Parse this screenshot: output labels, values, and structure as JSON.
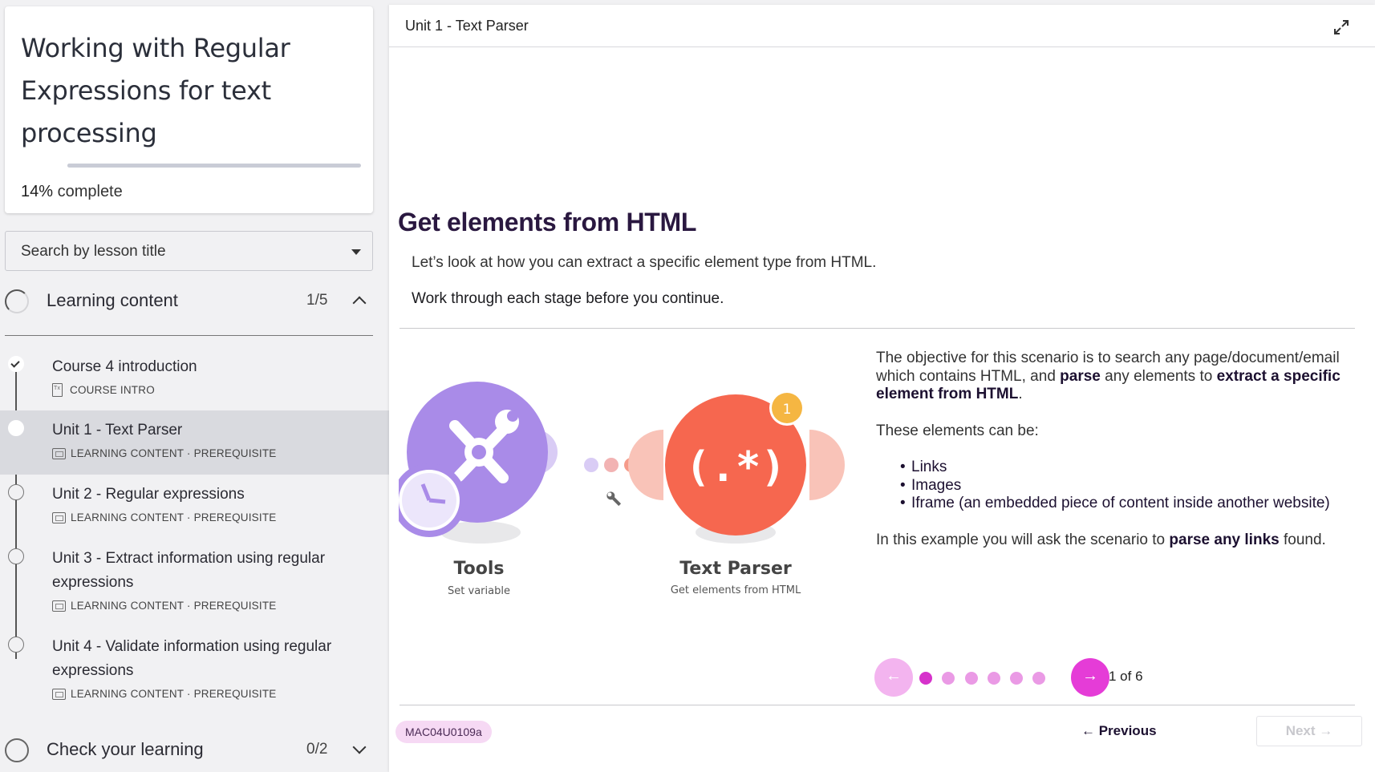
{
  "course": {
    "title": "Working with Regular Expressions for text processing",
    "progress_percent": 14,
    "progress_value": "14%",
    "progress_suffix": " complete"
  },
  "search": {
    "placeholder": "Search by lesson title"
  },
  "sections": [
    {
      "title": "Learning content",
      "count": "1/5",
      "expanded": true,
      "lessons": [
        {
          "name": "Course 4 introduction",
          "meta": "COURSE INTRO",
          "status": "complete"
        },
        {
          "name": "Unit 1 - Text Parser",
          "meta": "LEARNING CONTENT · PREREQUISITE",
          "status": "current"
        },
        {
          "name": "Unit 2 - Regular expressions",
          "meta": "LEARNING CONTENT · PREREQUISITE",
          "status": "not-started"
        },
        {
          "name": "Unit 3 - Extract information using regular expressions",
          "meta": "LEARNING CONTENT · PREREQUISITE",
          "status": "not-started"
        },
        {
          "name": "Unit 4 - Validate information using regular expressions",
          "meta": "LEARNING CONTENT · PREREQUISITE",
          "status": "not-started"
        }
      ]
    },
    {
      "title": "Check your learning",
      "count": "0/2",
      "expanded": false
    }
  ],
  "main": {
    "unit_title": "Unit 1 - Text Parser",
    "heading": "Get elements from HTML",
    "lead": "Let’s look at how you can extract a specific element type from HTML.",
    "lead_strong": "Work through each stage before you continue.",
    "diagram": {
      "left_module": {
        "name": "Tools",
        "sub": "Set variable",
        "color": "#a98be8"
      },
      "right_module": {
        "name": "Text Parser",
        "sub": "Get elements from HTML",
        "color": "#f6674f",
        "badge": "1",
        "glyph": "(.*)"
      }
    },
    "description": {
      "p1_a": "The objective for this scenario is to search any page/document/email which contains HTML, and ",
      "p1_b": "parse",
      "p1_c": " any elements to ",
      "p1_d": "extract a specific element from HTML",
      "p1_e": ".",
      "p2": "These elements can be:",
      "items": [
        "Links",
        "Images",
        "Iframe (an embedded piece of content inside another website)"
      ],
      "p3_a": "In this example you will ask the scenario to ",
      "p3_b": "parse any links",
      "p3_c": " found."
    },
    "carousel": {
      "current": 1,
      "total": 6,
      "label": "1 of 6",
      "prev_icon": "←",
      "next_icon": "→"
    },
    "code": "MAC04U0109a",
    "previous_label": "← Previous",
    "next_label": "Next →"
  },
  "colors": {
    "accent": "#e53cd7",
    "accent_light": "#f3b4ef",
    "heading": "#2a1840"
  }
}
